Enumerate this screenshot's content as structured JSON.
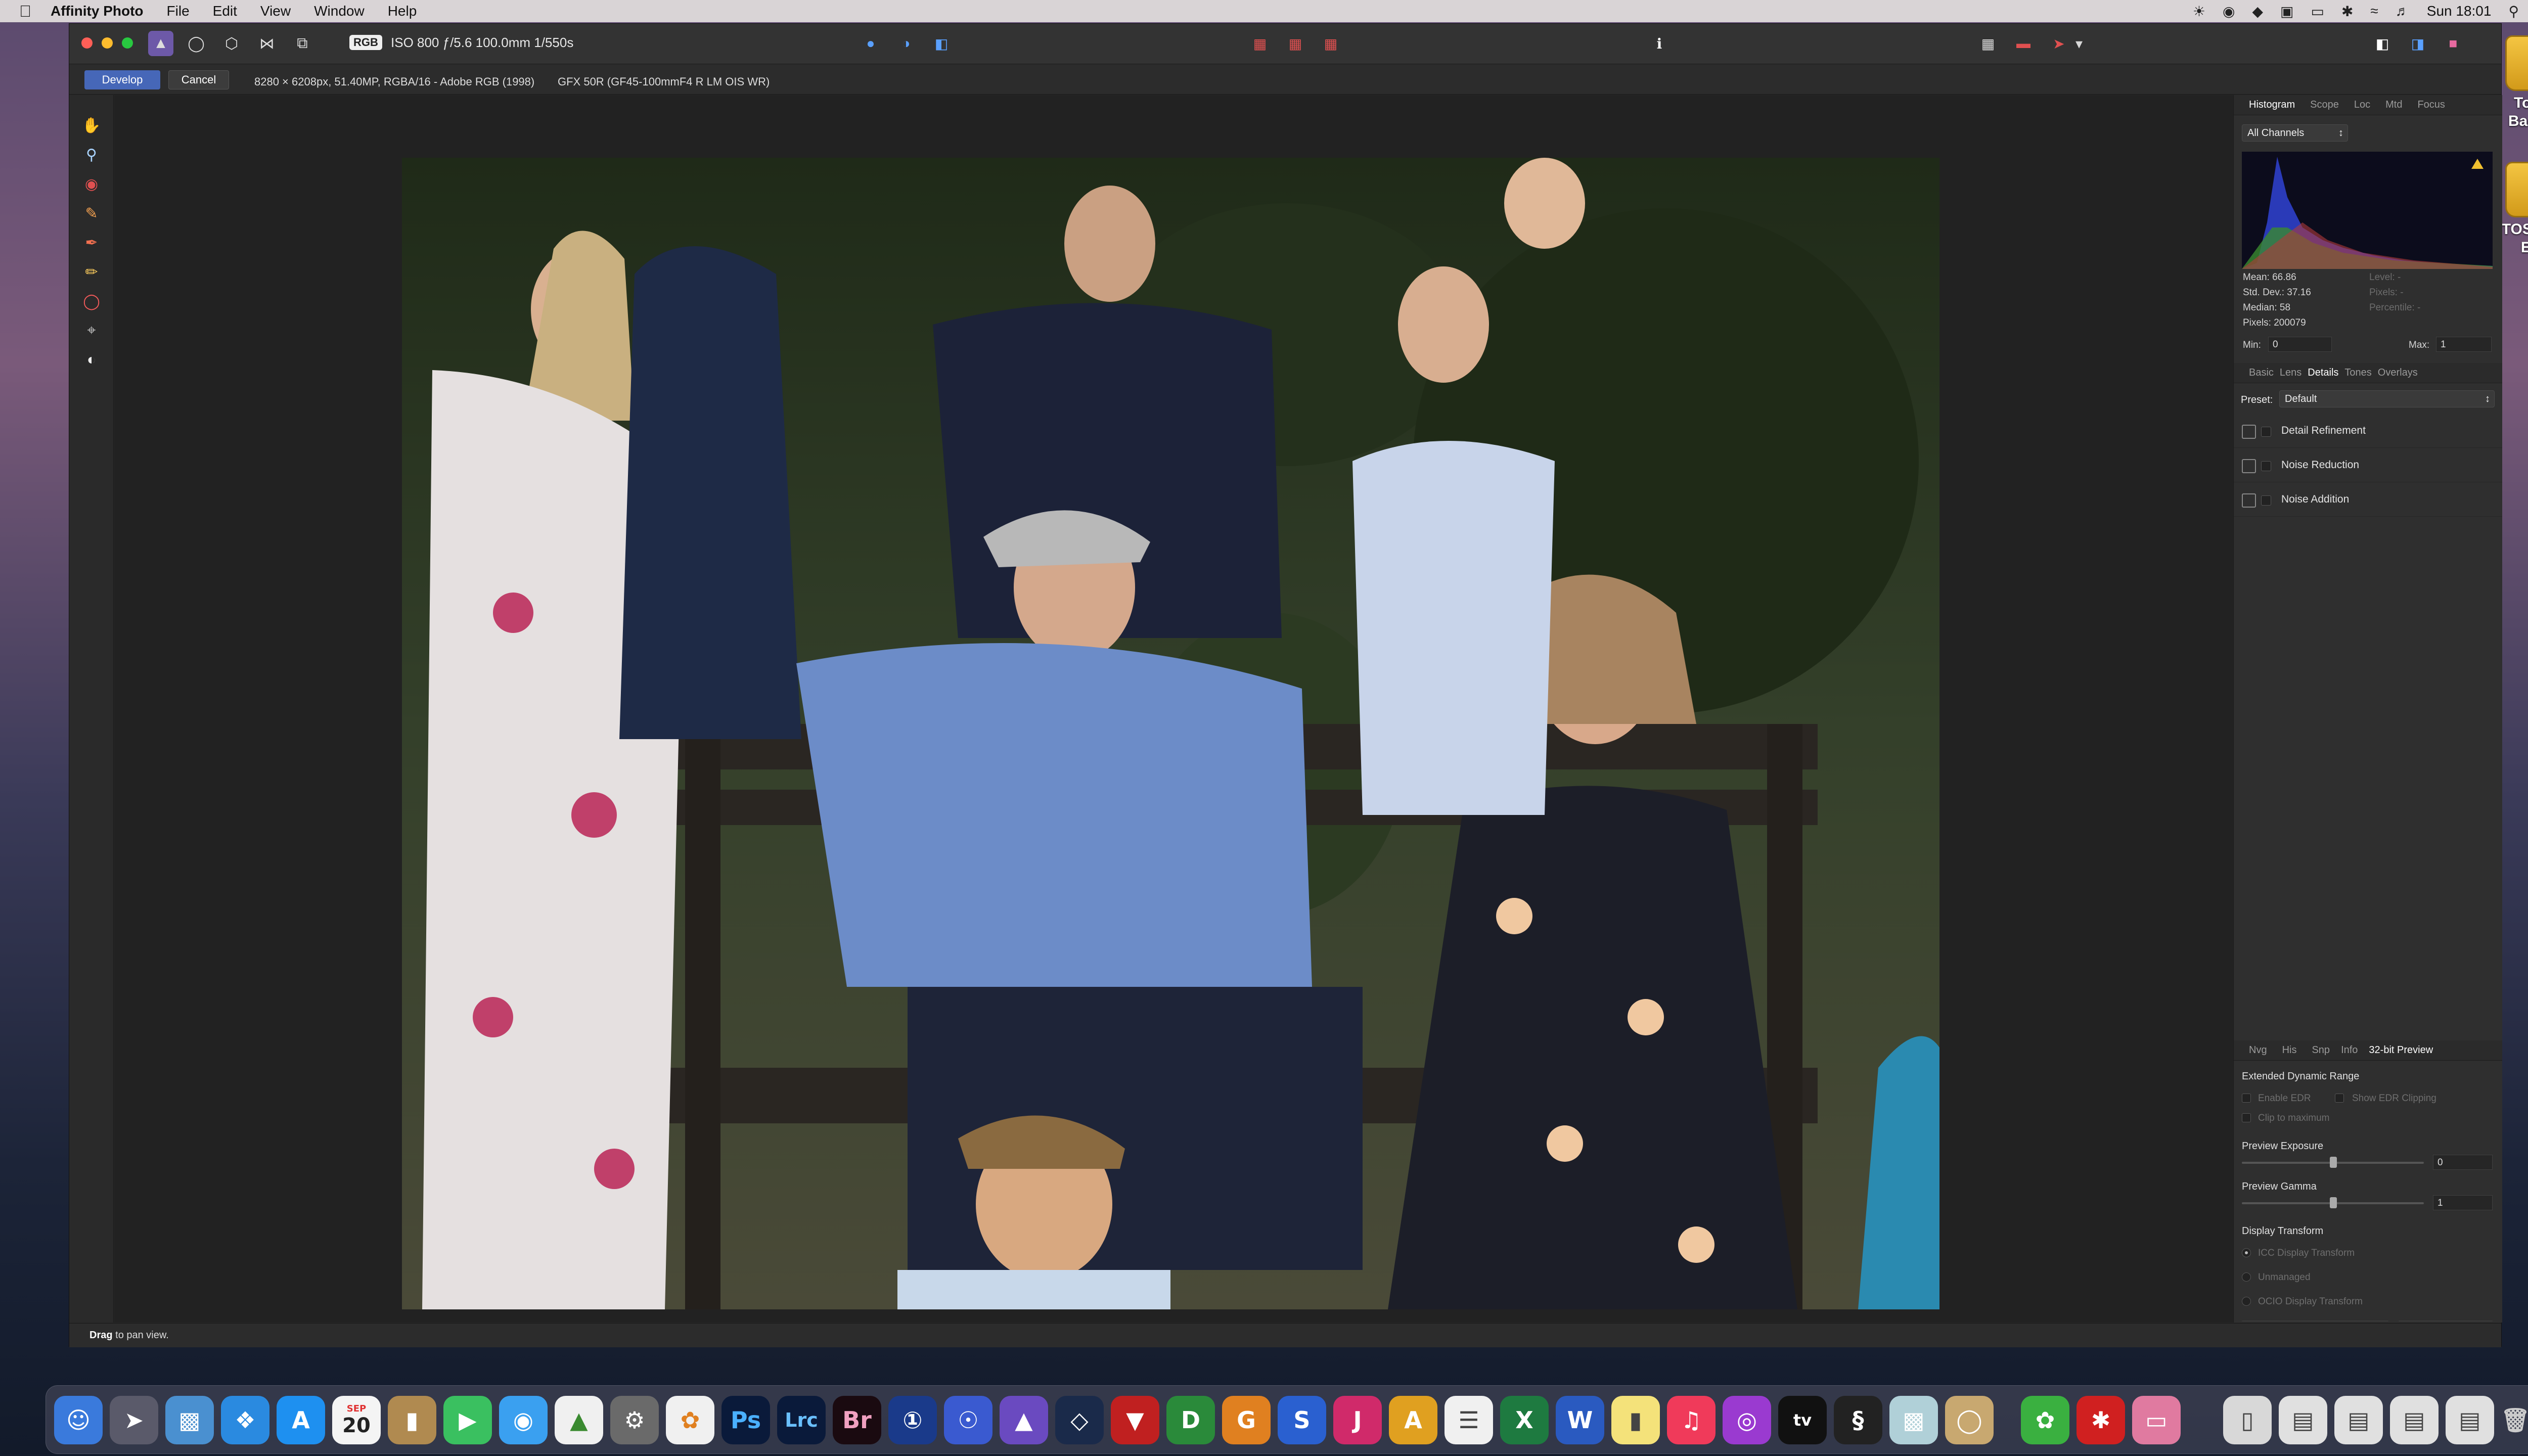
{
  "menubar": {
    "app_name": "Affinity Photo",
    "menus": [
      "File",
      "Edit",
      "View",
      "Window",
      "Help"
    ],
    "clock": "Sun 18:01"
  },
  "desktop": {
    "drives": [
      "Tonys Backup",
      "TOSHIBA EXT"
    ]
  },
  "toolbar": {
    "color_space": "RGB",
    "exif": "ISO 800 ƒ/5.6 100.0mm 1/550s"
  },
  "context": {
    "develop_label": "Develop",
    "cancel_label": "Cancel",
    "image_info": "8280 × 6208px, 51.40MP, RGBA/16 - Adobe RGB (1998)",
    "camera_info": "GFX 50R (GF45-100mmF4 R LM OIS WR)"
  },
  "histogram_panel": {
    "tabs": [
      "Histogram",
      "Scope",
      "Loc",
      "Mtd",
      "Focus"
    ],
    "active_tab": "Histogram",
    "channel": "All Channels",
    "mean": "Mean: 66.86",
    "std_dev": "Std. Dev.: 37.16",
    "median": "Median: 58",
    "pixels": "Pixels: 200079",
    "level": "Level: -",
    "pixels_right": "Pixels: -",
    "percentile": "Percentile: -",
    "min_label": "Min:",
    "min_value": "0",
    "max_label": "Max:",
    "max_value": "1"
  },
  "details_panel": {
    "tabs": [
      "Basic",
      "Lens",
      "Details",
      "Tones",
      "Overlays"
    ],
    "active_tab": "Details",
    "preset_label": "Preset:",
    "preset_value": "Default",
    "adjustments": [
      "Detail Refinement",
      "Noise Reduction",
      "Noise Addition"
    ]
  },
  "preview_panel": {
    "tabs": [
      "Nvg",
      "His",
      "Snp",
      "Info",
      "32-bit Preview"
    ],
    "active_tab": "32-bit Preview",
    "edr_heading": "Extended Dynamic Range",
    "enable_edr": "Enable EDR",
    "show_edr_clipping": "Show EDR Clipping",
    "clip_to_maximum": "Clip to maximum",
    "preview_exposure": "Preview Exposure",
    "exposure_value": "0",
    "preview_gamma": "Preview Gamma",
    "gamma_value": "1",
    "display_transform": "Display Transform",
    "icc": "ICC Display Transform",
    "unmanaged": "Unmanaged",
    "ocio": "OCIO Display Transform"
  },
  "status": {
    "bold": "Drag",
    "text": " to pan view."
  },
  "dock": {
    "calendar_month": "SEP",
    "calendar_day": "20",
    "labeled_apps": [
      "Ps",
      "Lrc",
      "Br",
      "D",
      "G",
      "S",
      "J",
      "A",
      "X",
      "W"
    ]
  },
  "colors": {
    "accent": "#4667b8",
    "panel": "#2f2f2f",
    "canvas": "#222222"
  }
}
